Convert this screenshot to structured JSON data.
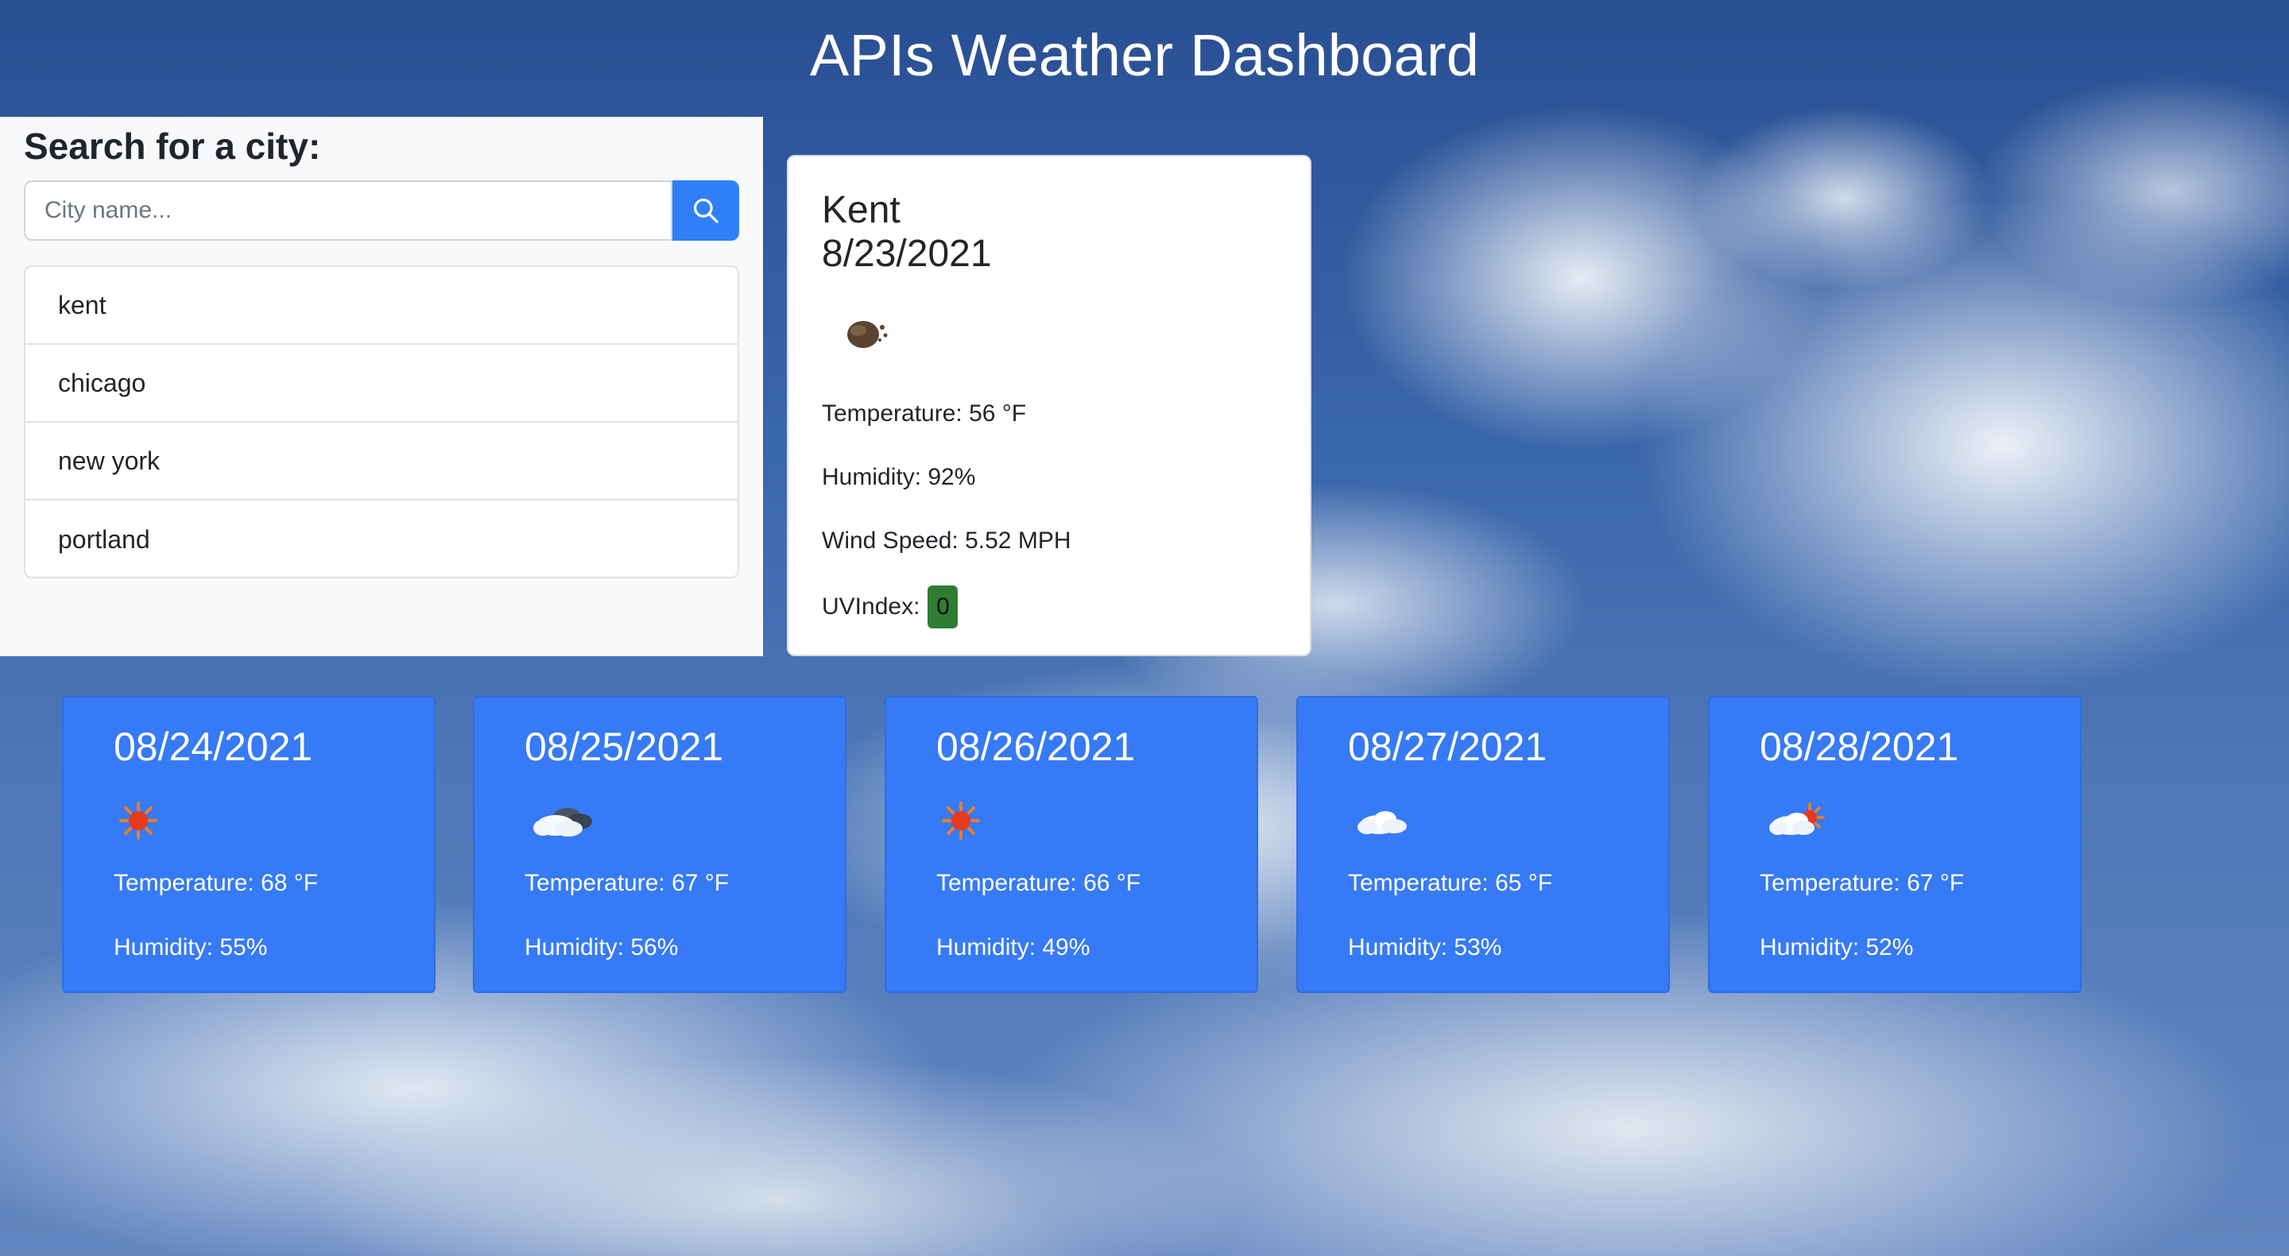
{
  "header": {
    "title": "APIs Weather Dashboard"
  },
  "search": {
    "heading": "Search for a city:",
    "placeholder": "City name...",
    "button_icon": "search-icon"
  },
  "history": [
    "kent",
    "chicago",
    "new york",
    "portland"
  ],
  "current": {
    "city": "Kent",
    "date": "8/23/2021",
    "icon": "night-cloud-icon",
    "temperature": "Temperature: 56 °F",
    "humidity": "Humidity: 92%",
    "wind": "Wind Speed: 5.52 MPH",
    "uv_label": "UVIndex:",
    "uv_value": "0",
    "uv_color": "#2e7d32"
  },
  "forecast": [
    {
      "date": "08/24/2021",
      "icon": "sun-icon",
      "temperature": "Temperature: 68 °F",
      "humidity": "Humidity: 55%"
    },
    {
      "date": "08/25/2021",
      "icon": "cloudy-icon",
      "temperature": "Temperature: 67 °F",
      "humidity": "Humidity: 56%"
    },
    {
      "date": "08/26/2021",
      "icon": "sun-icon",
      "temperature": "Temperature: 66 °F",
      "humidity": "Humidity: 49%"
    },
    {
      "date": "08/27/2021",
      "icon": "cloud-icon",
      "temperature": "Temperature: 65 °F",
      "humidity": "Humidity: 53%"
    },
    {
      "date": "08/28/2021",
      "icon": "partly-cloudy-icon",
      "temperature": "Temperature: 67 °F",
      "humidity": "Humidity: 52%"
    }
  ],
  "colors": {
    "accent": "#367af5",
    "search_button": "#2f80f8",
    "panel_background": "#f8f9fa"
  }
}
